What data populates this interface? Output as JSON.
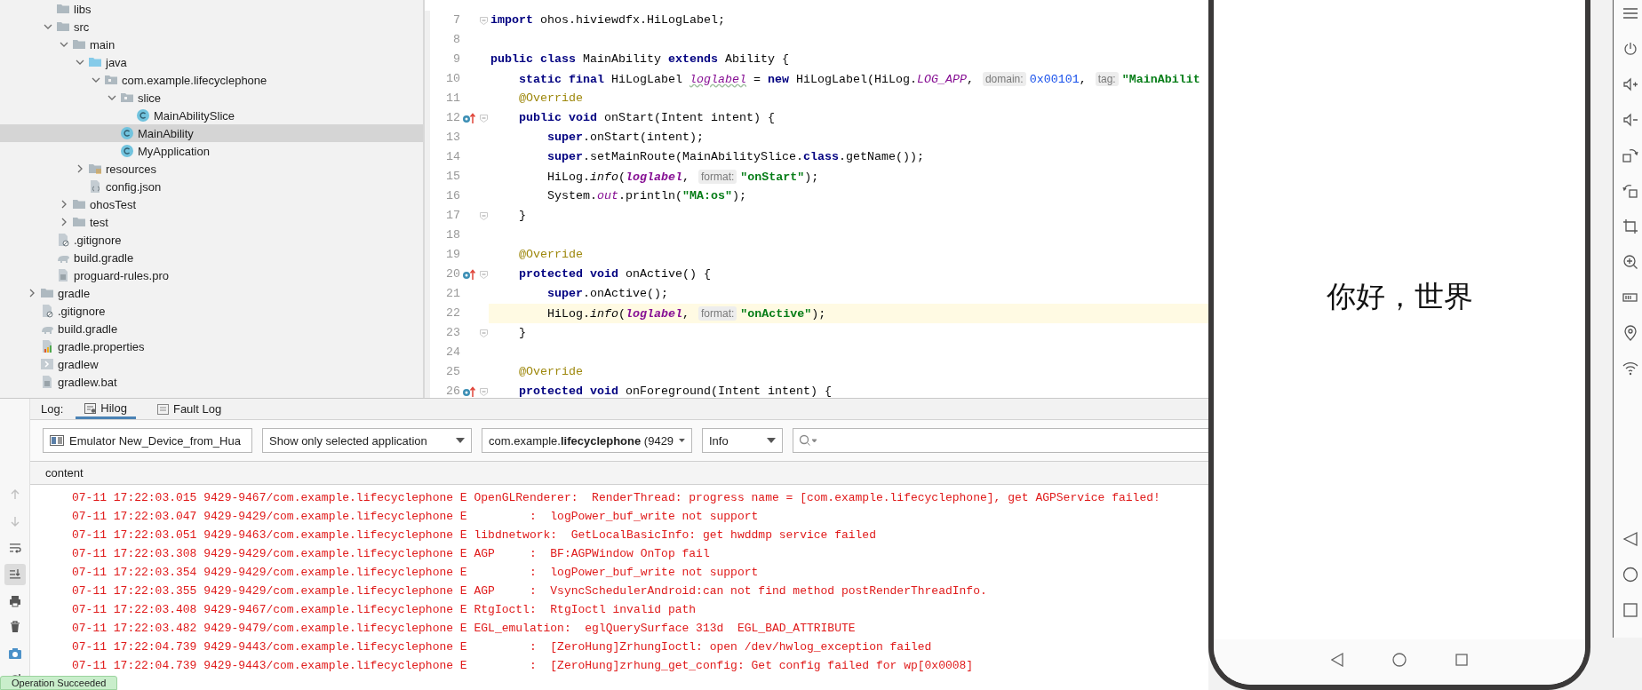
{
  "project_tree": {
    "items": [
      {
        "children": [
          {
            "label": "libs",
            "kind": "folder",
            "selected": false
          },
          {
            "label": "src",
            "kind": "folder",
            "expanded": true,
            "selected": false,
            "children": [
              {
                "label": "main",
                "kind": "folder",
                "expanded": true,
                "selected": false,
                "children": [
                  {
                    "label": "java",
                    "kind": "source-folder",
                    "expanded": true,
                    "selected": false,
                    "children": [
                      {
                        "label": "com.example.lifecyclephone",
                        "kind": "package",
                        "expanded": true,
                        "selected": false,
                        "children": [
                          {
                            "label": "slice",
                            "kind": "package",
                            "expanded": true,
                            "selected": false,
                            "children": [
                              {
                                "label": "MainAbilitySlice",
                                "kind": "class",
                                "selected": false
                              }
                            ]
                          },
                          {
                            "label": "MainAbility",
                            "kind": "class",
                            "selected": true
                          },
                          {
                            "label": "MyApplication",
                            "kind": "class",
                            "selected": false
                          }
                        ]
                      }
                    ]
                  },
                  {
                    "label": "resources",
                    "kind": "resources",
                    "expanded": false,
                    "selected": false
                  },
                  {
                    "label": "config.json",
                    "kind": "json",
                    "selected": false
                  }
                ]
              },
              {
                "label": "ohosTest",
                "kind": "folder",
                "expanded": false,
                "selected": false
              },
              {
                "label": "test",
                "kind": "folder",
                "expanded": false,
                "selected": false
              }
            ]
          },
          {
            "label": ".gitignore",
            "kind": "ignore",
            "selected": false
          },
          {
            "label": "build.gradle",
            "kind": "gradle",
            "selected": false
          },
          {
            "label": "proguard-rules.pro",
            "kind": "text",
            "selected": false
          }
        ]
      },
      {
        "label": "gradle",
        "kind": "folder",
        "expanded": false,
        "selected": false
      },
      {
        "label": ".gitignore",
        "kind": "ignore",
        "selected": false
      },
      {
        "label": "build.gradle",
        "kind": "gradle",
        "selected": false
      },
      {
        "label": "gradle.properties",
        "kind": "properties",
        "selected": false
      },
      {
        "label": "gradlew",
        "kind": "script",
        "selected": false
      },
      {
        "label": "gradlew.bat",
        "kind": "text",
        "selected": false
      }
    ]
  },
  "editor": {
    "lines": [
      {
        "number": "7",
        "current": false,
        "gutter_mark": false,
        "fold": true,
        "tokens": [
          {
            "kind": "kw",
            "text": "import"
          },
          {
            "kind": "plain",
            "text": " ohos.hiviewdfx.HiLogLabel;"
          }
        ]
      },
      {
        "number": "8",
        "current": false,
        "gutter_mark": false,
        "fold": false
      },
      {
        "number": "9",
        "current": false,
        "gutter_mark": false,
        "fold": false,
        "tokens": [
          {
            "kind": "kw",
            "text": "public class"
          },
          {
            "kind": "plain",
            "text": " MainAbility "
          },
          {
            "kind": "kw",
            "text": "extends"
          },
          {
            "kind": "plain",
            "text": " Ability {"
          }
        ]
      },
      {
        "number": "10",
        "current": false,
        "gutter_mark": false,
        "fold": false,
        "tokens": [
          {
            "kind": "kw",
            "text": "    static final"
          },
          {
            "kind": "plain",
            "text": " HiLogLabel "
          },
          {
            "kind": "unused",
            "text": "loglabel"
          },
          {
            "kind": "plain",
            "text": " = "
          },
          {
            "kind": "kw",
            "text": "new"
          },
          {
            "kind": "plain",
            "text": " HiLogLabel(HiLog."
          },
          {
            "kind": "const",
            "text": "LOG_APP"
          },
          {
            "kind": "plain",
            "text": ", "
          },
          {
            "kind": "hint",
            "text": "domain:"
          },
          {
            "kind": "num",
            "text": "0x00101"
          },
          {
            "kind": "plain",
            "text": ", "
          },
          {
            "kind": "hint",
            "text": "tag:"
          },
          {
            "kind": "str",
            "text": "\"MainAbilit"
          }
        ]
      },
      {
        "number": "11",
        "current": false,
        "gutter_mark": false,
        "fold": false,
        "tokens": [
          {
            "kind": "ann",
            "text": "    @Override"
          }
        ]
      },
      {
        "number": "12",
        "current": false,
        "gutter_mark": true,
        "fold": true,
        "tokens": [
          {
            "kind": "kw",
            "text": "    public void"
          },
          {
            "kind": "plain",
            "text": " onStart(Intent intent) {"
          }
        ]
      },
      {
        "number": "13",
        "current": false,
        "gutter_mark": false,
        "fold": false,
        "tokens": [
          {
            "kind": "kw",
            "text": "        super"
          },
          {
            "kind": "plain",
            "text": ".onStart(intent);"
          }
        ]
      },
      {
        "number": "14",
        "current": false,
        "gutter_mark": false,
        "fold": false,
        "tokens": [
          {
            "kind": "kw",
            "text": "        super"
          },
          {
            "kind": "plain",
            "text": ".setMainRoute(MainAbilitySlice."
          },
          {
            "kind": "kw",
            "text": "class"
          },
          {
            "kind": "plain",
            "text": ".getName());"
          }
        ]
      },
      {
        "number": "15",
        "current": false,
        "gutter_mark": false,
        "fold": false,
        "tokens": [
          {
            "kind": "plain",
            "text": "        HiLog."
          },
          {
            "kind": "call",
            "text": "info"
          },
          {
            "kind": "plain",
            "text": "("
          },
          {
            "kind": "var",
            "text": "loglabel"
          },
          {
            "kind": "plain",
            "text": ", "
          },
          {
            "kind": "hint",
            "text": "format:"
          },
          {
            "kind": "str",
            "text": "\"onStart\""
          },
          {
            "kind": "plain",
            "text": ");"
          }
        ]
      },
      {
        "number": "16",
        "current": false,
        "gutter_mark": false,
        "fold": false,
        "tokens": [
          {
            "kind": "plain",
            "text": "        System."
          },
          {
            "kind": "const",
            "text": "out"
          },
          {
            "kind": "plain",
            "text": ".println("
          },
          {
            "kind": "str",
            "text": "\"MA:os\""
          },
          {
            "kind": "plain",
            "text": ");"
          }
        ]
      },
      {
        "number": "17",
        "current": false,
        "gutter_mark": false,
        "fold": true,
        "tokens": [
          {
            "kind": "plain",
            "text": "    }"
          }
        ]
      },
      {
        "number": "18",
        "current": false,
        "gutter_mark": false,
        "fold": false
      },
      {
        "number": "19",
        "current": false,
        "gutter_mark": false,
        "fold": false,
        "tokens": [
          {
            "kind": "ann",
            "text": "    @Override"
          }
        ]
      },
      {
        "number": "20",
        "current": false,
        "gutter_mark": true,
        "fold": true,
        "tokens": [
          {
            "kind": "kw",
            "text": "    protected void"
          },
          {
            "kind": "plain",
            "text": " onActive() {"
          }
        ]
      },
      {
        "number": "21",
        "current": false,
        "gutter_mark": false,
        "fold": false,
        "tokens": [
          {
            "kind": "kw",
            "text": "        super"
          },
          {
            "kind": "plain",
            "text": ".onActive();"
          }
        ]
      },
      {
        "number": "22",
        "current": true,
        "gutter_mark": false,
        "fold": false,
        "tokens": [
          {
            "kind": "plain",
            "text": "        HiLog."
          },
          {
            "kind": "call",
            "text": "info"
          },
          {
            "kind": "plain",
            "text": "("
          },
          {
            "kind": "var",
            "text": "loglabel"
          },
          {
            "kind": "plain",
            "text": ", "
          },
          {
            "kind": "hint",
            "text": "format:"
          },
          {
            "kind": "str",
            "text": "\"onActive\""
          },
          {
            "kind": "plain",
            "text": ");"
          }
        ]
      },
      {
        "number": "23",
        "current": false,
        "gutter_mark": false,
        "fold": true,
        "tokens": [
          {
            "kind": "plain",
            "text": "    }"
          }
        ]
      },
      {
        "number": "24",
        "current": false,
        "gutter_mark": false,
        "fold": false
      },
      {
        "number": "25",
        "current": false,
        "gutter_mark": false,
        "fold": false,
        "tokens": [
          {
            "kind": "ann",
            "text": "    @Override"
          }
        ]
      },
      {
        "number": "26",
        "current": false,
        "gutter_mark": true,
        "fold": true,
        "tokens": [
          {
            "kind": "kw",
            "text": "    protected void"
          },
          {
            "kind": "plain",
            "text": " onForeground(Intent intent) {"
          }
        ]
      }
    ]
  },
  "log": {
    "label": "Log:",
    "tabs": [
      {
        "label": "Hilog",
        "selected": true
      },
      {
        "label": "Fault Log",
        "selected": false
      }
    ],
    "filters": [
      {
        "kind": "device",
        "value": "Emulator New_Device_from_Hua"
      },
      {
        "kind": "plain",
        "value": "Show only selected application"
      },
      {
        "kind": "plain",
        "value": "com.example.**lifecyclephone** (9429"
      },
      {
        "kind": "plain",
        "value": "Info"
      }
    ],
    "tools": [
      {
        "disabled": true,
        "on": false
      },
      {
        "disabled": true,
        "on": false
      },
      {
        "disabled": false,
        "on": false
      },
      {
        "disabled": false,
        "on": true
      },
      {
        "disabled": false,
        "on": false
      },
      {
        "disabled": false,
        "on": false
      },
      {
        "disabled": false,
        "on": false
      },
      {
        "disabled": false,
        "on": false
      }
    ],
    "column": "content",
    "lines": [
      "07-11 17:22:03.015 9429-9467/com.example.lifecyclephone E OpenGLRenderer:  RenderThread: progress name = [com.example.lifecyclephone], get AGPService failed!",
      "07-11 17:22:03.047 9429-9429/com.example.lifecyclephone E         :  logPower_buf_write not support",
      "07-11 17:22:03.051 9429-9463/com.example.lifecyclephone E libdnetwork:  GetLocalBasicInfo: get hwddmp service failed",
      "07-11 17:22:03.308 9429-9429/com.example.lifecyclephone E AGP     :  BF:AGPWindow OnTop fail",
      "07-11 17:22:03.354 9429-9429/com.example.lifecyclephone E         :  logPower_buf_write not support",
      "07-11 17:22:03.355 9429-9429/com.example.lifecyclephone E AGP     :  VsyncSchedulerAndroid:can not find method postRenderThreadInfo.",
      "07-11 17:22:03.408 9429-9467/com.example.lifecyclephone E RtgIoctl:  RtgIoctl invalid path",
      "07-11 17:22:03.482 9429-9479/com.example.lifecyclephone E EGL_emulation:  eglQuerySurface 313d  EGL_BAD_ATTRIBUTE",
      "07-11 17:22:04.739 9429-9443/com.example.lifecyclephone E         :  [ZeroHung]ZrhungIoctl: open /dev/hwlog_exception failed",
      "07-11 17:22:04.739 9429-9443/com.example.lifecyclephone E         :  [ZeroHung]zrhung_get_config: Get config failed for wp[0x0008]"
    ]
  },
  "phone": {
    "screen_text": "你好，世界"
  },
  "toast": "Operation Succeeded"
}
